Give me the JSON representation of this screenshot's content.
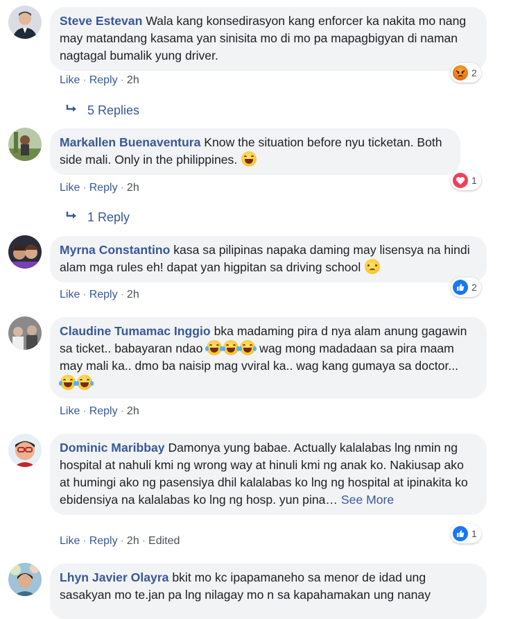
{
  "comments": [
    {
      "author": "Steve Estevan",
      "text": "Wala kang konsediraysyon kang enforcer ka nakita mo nang may matandang kasama yan sinisita mo di mo pa mapagbigyan di naman nagtagal bumalik yung driver.",
      "text_display": "Wala kang konsedirasyon kang enforcer ka nakita mo nang may matandang kasama yan sinisita mo di mo pa mapagbigyan di naman nagtagal bumalik yung driver.",
      "like": "Like",
      "reply": "Reply",
      "time": "2h",
      "reaction": {
        "icon": "angry-reaction-icon",
        "count": "2"
      },
      "replies_label": "5 Replies"
    },
    {
      "author": "Markallen Buenaventura",
      "text_display": "Know the situation before nyu ticketan. Both side mali. Only in the philippines.",
      "like": "Like",
      "reply": "Reply",
      "time": "2h",
      "reaction": {
        "icon": "love-reaction-icon",
        "count": "1"
      },
      "replies_label": "1 Reply"
    },
    {
      "author": "Myrna Constantino",
      "text_display": "kasa sa pilipinas napaka daming may lisensya na hindi alam mga rules eh! dapat yan higpitan sa driving school",
      "like": "Like",
      "reply": "Reply",
      "time": "2h",
      "reaction": {
        "icon": "like-reaction-icon",
        "count": "2"
      }
    },
    {
      "author": "Claudine Tumamac Inggio",
      "text_part1": "bka madaming pira d nya alam anung gagawin sa ticket.. babayaran ndao",
      "text_part2": "wag mong madadaan sa pira maam may mali ka.. dmo ba naisip mag vviral ka.. wag kang gumaya sa doctor...",
      "like": "Like",
      "reply": "Reply",
      "time": "2h"
    },
    {
      "author": "Dominic Maribbay",
      "text_display": "Damonya yung babae. Actually kalalabas lng nmin ng hospital at nahuli kmi ng wrong way at hinuli kmi ng anak ko. Nakiusap ako at humingi ako ng pasensiya dhil kalalabas ko lng ng hospital at ipinakita ko ebidensiya na kalalabas ko lng ng hosp. yun pina…",
      "see_more": "See More",
      "like": "Like",
      "reply": "Reply",
      "time": "2h",
      "edited": "Edited",
      "reaction": {
        "icon": "like-reaction-icon",
        "count": "1"
      }
    },
    {
      "author": "Lhyn Javier Olayra",
      "text_display": "bkit mo kc ipapamaneho sa menor de idad ung sasakyan mo te.jan pa lng nilagay mo n sa kapahamakan ung nanay"
    }
  ],
  "colors": {
    "author": "#385898",
    "bubble": "#f2f3f5",
    "meta": "#4b4f56"
  }
}
